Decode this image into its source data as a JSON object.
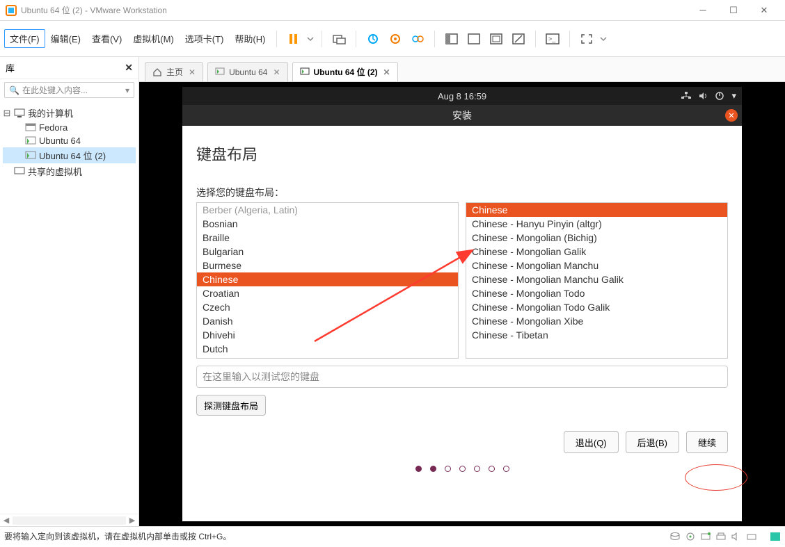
{
  "window": {
    "title": "Ubuntu 64 位 (2) - VMware Workstation"
  },
  "menu": {
    "file": "文件(F)",
    "edit": "编辑(E)",
    "view": "查看(V)",
    "vm": "虚拟机(M)",
    "tabs": "选项卡(T)",
    "help": "帮助(H)"
  },
  "library": {
    "title": "库",
    "search_placeholder": "在此处键入内容...",
    "mycomputer": "我的计算机",
    "items": [
      "Fedora",
      "Ubuntu 64",
      "Ubuntu 64 位 (2)"
    ],
    "shared": "共享的虚拟机"
  },
  "tabs": {
    "home": "主页",
    "t1": "Ubuntu 64",
    "t2": "Ubuntu 64 位 (2)"
  },
  "gnome": {
    "clock": "Aug 8  16:59"
  },
  "installer": {
    "wintitle": "安装",
    "heading": "键盘布局",
    "choose_label": "选择您的键盘布局：",
    "left_cut": "Berber (Algeria, Latin)",
    "left": [
      "Bosnian",
      "Braille",
      "Bulgarian",
      "Burmese",
      "Chinese",
      "Croatian",
      "Czech",
      "Danish",
      "Dhivehi",
      "Dutch"
    ],
    "left_selected": "Chinese",
    "right": [
      "Chinese",
      "Chinese - Hanyu Pinyin (altgr)",
      "Chinese - Mongolian (Bichig)",
      "Chinese - Mongolian Galik",
      "Chinese - Mongolian Manchu",
      "Chinese - Mongolian Manchu Galik",
      "Chinese - Mongolian Todo",
      "Chinese - Mongolian Todo Galik",
      "Chinese - Mongolian Xibe",
      "Chinese - Tibetan"
    ],
    "right_selected": "Chinese",
    "test_placeholder": "在这里输入以测试您的键盘",
    "detect": "探测键盘布局",
    "quit": "退出(Q)",
    "back": "后退(B)",
    "continue": "继续"
  },
  "status": {
    "text": "要将输入定向到该虚拟机，请在虚拟机内部单击或按 Ctrl+G。"
  }
}
